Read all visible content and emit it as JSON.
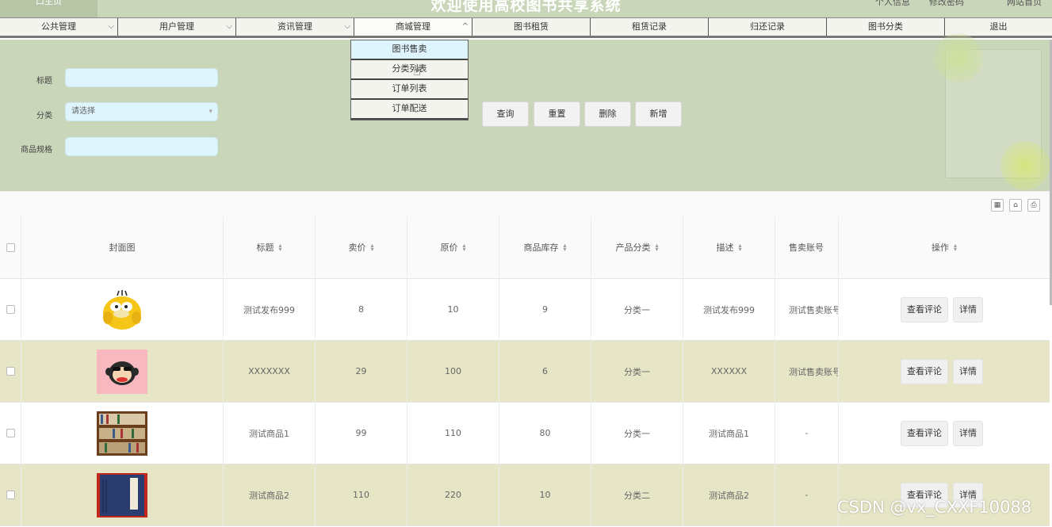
{
  "header": {
    "home": "口主页",
    "title": "欢迎使用高校图书共享系统",
    "links": [
      "个人信息",
      "修改密码",
      "网站首页"
    ]
  },
  "nav": [
    {
      "label": "公共管理",
      "chevron": "down"
    },
    {
      "label": "用户管理",
      "chevron": "down"
    },
    {
      "label": "资讯管理",
      "chevron": "down"
    },
    {
      "label": "商城管理",
      "chevron": "up"
    },
    {
      "label": "图书租赁",
      "chevron": ""
    },
    {
      "label": "租赁记录",
      "chevron": ""
    },
    {
      "label": "归还记录",
      "chevron": ""
    },
    {
      "label": "图书分类",
      "chevron": ""
    },
    {
      "label": "退出",
      "chevron": ""
    }
  ],
  "dropdown": [
    "图书售卖",
    "分类列表",
    "订单列表",
    "订单配送"
  ],
  "search": {
    "title_label": "标题",
    "category_label": "分类",
    "category_placeholder": "请选择",
    "spec_label": "商品规格",
    "buttons": [
      "查询",
      "重置",
      "删除",
      "新增"
    ]
  },
  "table": {
    "columns": [
      "封面图",
      "标题",
      "卖价",
      "原价",
      "商品库存",
      "产品分类",
      "描述",
      "售卖账号",
      "操作"
    ],
    "rows": [
      {
        "title": "测试发布999",
        "price": "8",
        "orig": "10",
        "stock": "9",
        "category": "分类一",
        "desc": "测试发布999",
        "account": "测试售卖账号"
      },
      {
        "title": "XXXXXXX",
        "price": "29",
        "orig": "100",
        "stock": "6",
        "category": "分类一",
        "desc": "XXXXXX",
        "account": "测试售卖账号"
      },
      {
        "title": "测试商品1",
        "price": "99",
        "orig": "110",
        "stock": "80",
        "category": "分类一",
        "desc": "测试商品1",
        "account": "-"
      },
      {
        "title": "测试商品2",
        "price": "110",
        "orig": "220",
        "stock": "10",
        "category": "分类二",
        "desc": "测试商品2",
        "account": "-"
      }
    ],
    "op_buttons": [
      "查看评论",
      "详情"
    ]
  },
  "watermark": "CSDN @vx_CXXF10088"
}
